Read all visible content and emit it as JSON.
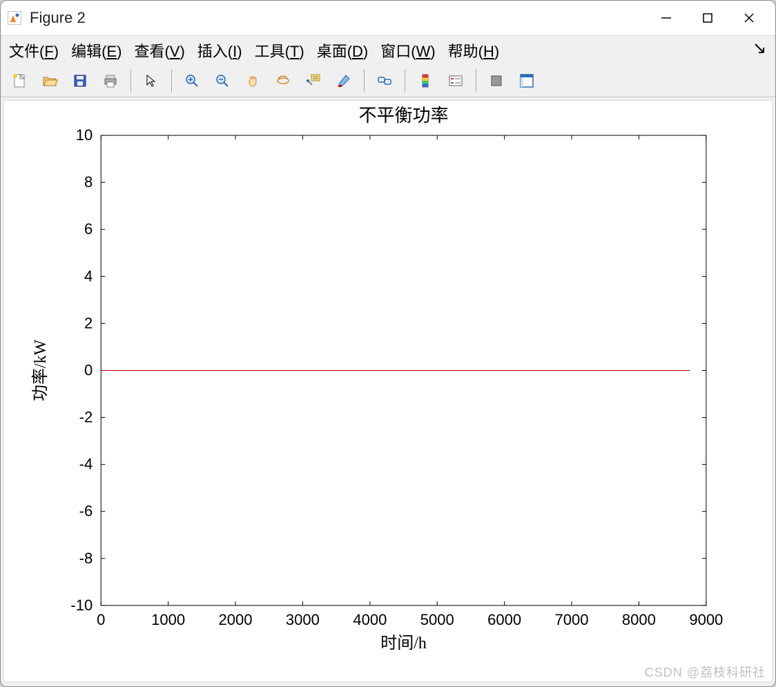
{
  "window": {
    "title": "Figure 2"
  },
  "menu": {
    "file": "文件(F)",
    "edit": "编辑(E)",
    "view": "查看(V)",
    "insert": "插入(I)",
    "tools": "工具(T)",
    "desktop": "桌面(D)",
    "window": "窗口(W)",
    "help": "帮助(H)"
  },
  "toolbar": {
    "new": "New Figure",
    "open": "Open",
    "save": "Save",
    "print": "Print",
    "pointer": "Edit Plot",
    "zoom_in": "Zoom In",
    "zoom_out": "Zoom Out",
    "pan": "Pan",
    "rotate": "Rotate 3D",
    "data_cursor": "Data Cursor",
    "brush": "Brush",
    "link": "Link Plot",
    "colorbar": "Insert Colorbar",
    "legend": "Insert Legend",
    "hide": "Hide Plot Tools",
    "show": "Show Plot Tools"
  },
  "chart_data": {
    "type": "line",
    "title": "不平衡功率",
    "xlabel": "时间/h",
    "ylabel": "功率/kW",
    "xlim": [
      0,
      9000
    ],
    "ylim": [
      -10,
      10
    ],
    "xticks": [
      0,
      1000,
      2000,
      3000,
      4000,
      5000,
      6000,
      7000,
      8000,
      9000
    ],
    "yticks": [
      -10,
      -8,
      -6,
      -4,
      -2,
      0,
      2,
      4,
      6,
      8,
      10
    ],
    "series": [
      {
        "name": "不平衡功率",
        "color": "#c00000",
        "x": [
          0,
          8760
        ],
        "y": [
          0,
          0
        ]
      }
    ]
  },
  "watermark": "CSDN @荔枝科研社"
}
